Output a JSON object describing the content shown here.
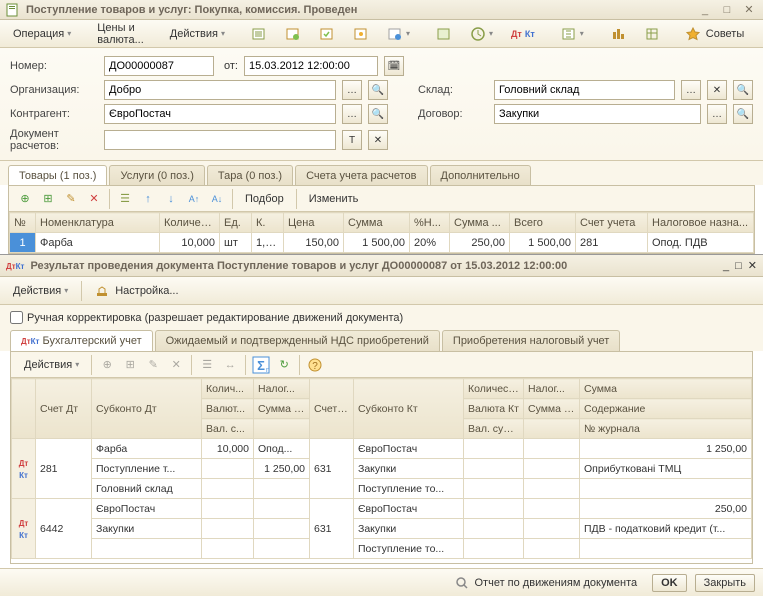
{
  "window": {
    "title": "Поступление товаров и услуг: Покупка, комиссия. Проведен"
  },
  "toolbar": {
    "operation": "Операция",
    "prices": "Цены и валюта...",
    "actions": "Действия",
    "tips": "Советы"
  },
  "form": {
    "number_label": "Номер:",
    "number": "ДО00000087",
    "from_label": "от:",
    "date": "15.03.2012 12:00:00",
    "org_label": "Организация:",
    "org": "Добро",
    "sklad_label": "Склад:",
    "sklad": "Головний склад",
    "contr_label": "Контрагент:",
    "contr": "ЄвроПостач",
    "dogovor_label": "Договор:",
    "dogovor": "Закупки",
    "doc_label": "Документ расчетов:"
  },
  "tabs": {
    "goods": "Товары (1 поз.)",
    "services": "Услуги (0 поз.)",
    "tara": "Тара (0 поз.)",
    "accounts": "Счета учета расчетов",
    "extra": "Дополнительно"
  },
  "goods_grid": {
    "podбор": "Подбор",
    "change": "Изменить",
    "cols": [
      "№",
      "Номенклатура",
      "Количес...",
      "Ед.",
      "К.",
      "Цена",
      "Сумма",
      "%Н...",
      "Сумма ...",
      "Всего",
      "Счет учета",
      "Налоговое назна..."
    ],
    "rows": [
      {
        "n": "1",
        "nom": "Фарба",
        "qty": "10,000",
        "ed": "шт",
        "k": "1,0...",
        "price": "150,00",
        "sum": "1 500,00",
        "vat": "20%",
        "vatsum": "250,00",
        "total": "1 500,00",
        "acct": "281",
        "tax": "Опод. ПДВ"
      }
    ]
  },
  "lower_window": {
    "title": "Результат проведения документа Поступление товаров и услуг ДО00000087 от 15.03.2012 12:00:00"
  },
  "lower_toolbar": {
    "actions": "Действия",
    "settings": "Настройка..."
  },
  "checkbox": {
    "label": "Ручная корректировка (разрешает редактирование движений документа)"
  },
  "lower_tabs": {
    "buh": "Бухгалтерский учет",
    "nds": "Ожидаемый и подтвержденный НДС приобретений",
    "nal": "Приобретения налоговый учет"
  },
  "lower_grid": {
    "actions": "Действия",
    "header1": [
      "",
      "Счет Дт",
      "Субконто Дт",
      "Колич...",
      "Налог...",
      "Счет Кт",
      "Субконто Кт",
      "Количест...",
      "Налог...",
      "Сумма"
    ],
    "header2": [
      "",
      "",
      "",
      "Валют...",
      "Сумма (н/у) Дт",
      "",
      "",
      "Валюта Кт",
      "Сумма (н/у) Кт",
      "Содержание"
    ],
    "header3": [
      "",
      "",
      "",
      "Вал. с...",
      "",
      "",
      "",
      "Вал. сум...",
      "",
      "№ журнала"
    ],
    "rows": [
      {
        "acc_dt": "281",
        "sub_dt": [
          "Фарба",
          "Поступление т...",
          "Головний склад"
        ],
        "qty": "10,000",
        "nal_dt": "Опод...",
        "sum_nu": "1 250,00",
        "acc_kt": "631",
        "sub_kt": [
          "ЄвроПостач",
          "Закупки",
          "Поступление то..."
        ],
        "sum": "1 250,00",
        "content": "Оприбутковані ТМЦ"
      },
      {
        "acc_dt": "6442",
        "sub_dt": [
          "ЄвроПостач",
          "Закупки",
          ""
        ],
        "qty": "",
        "nal_dt": "",
        "sum_nu": "",
        "acc_kt": "631",
        "sub_kt": [
          "ЄвроПостач",
          "Закупки",
          "Поступление то..."
        ],
        "sum": "250,00",
        "content": "ПДВ - податковий кредит (т..."
      }
    ]
  },
  "footer": {
    "report": "Отчет по движениям документа",
    "ok": "OK",
    "close": "Закрыть"
  }
}
